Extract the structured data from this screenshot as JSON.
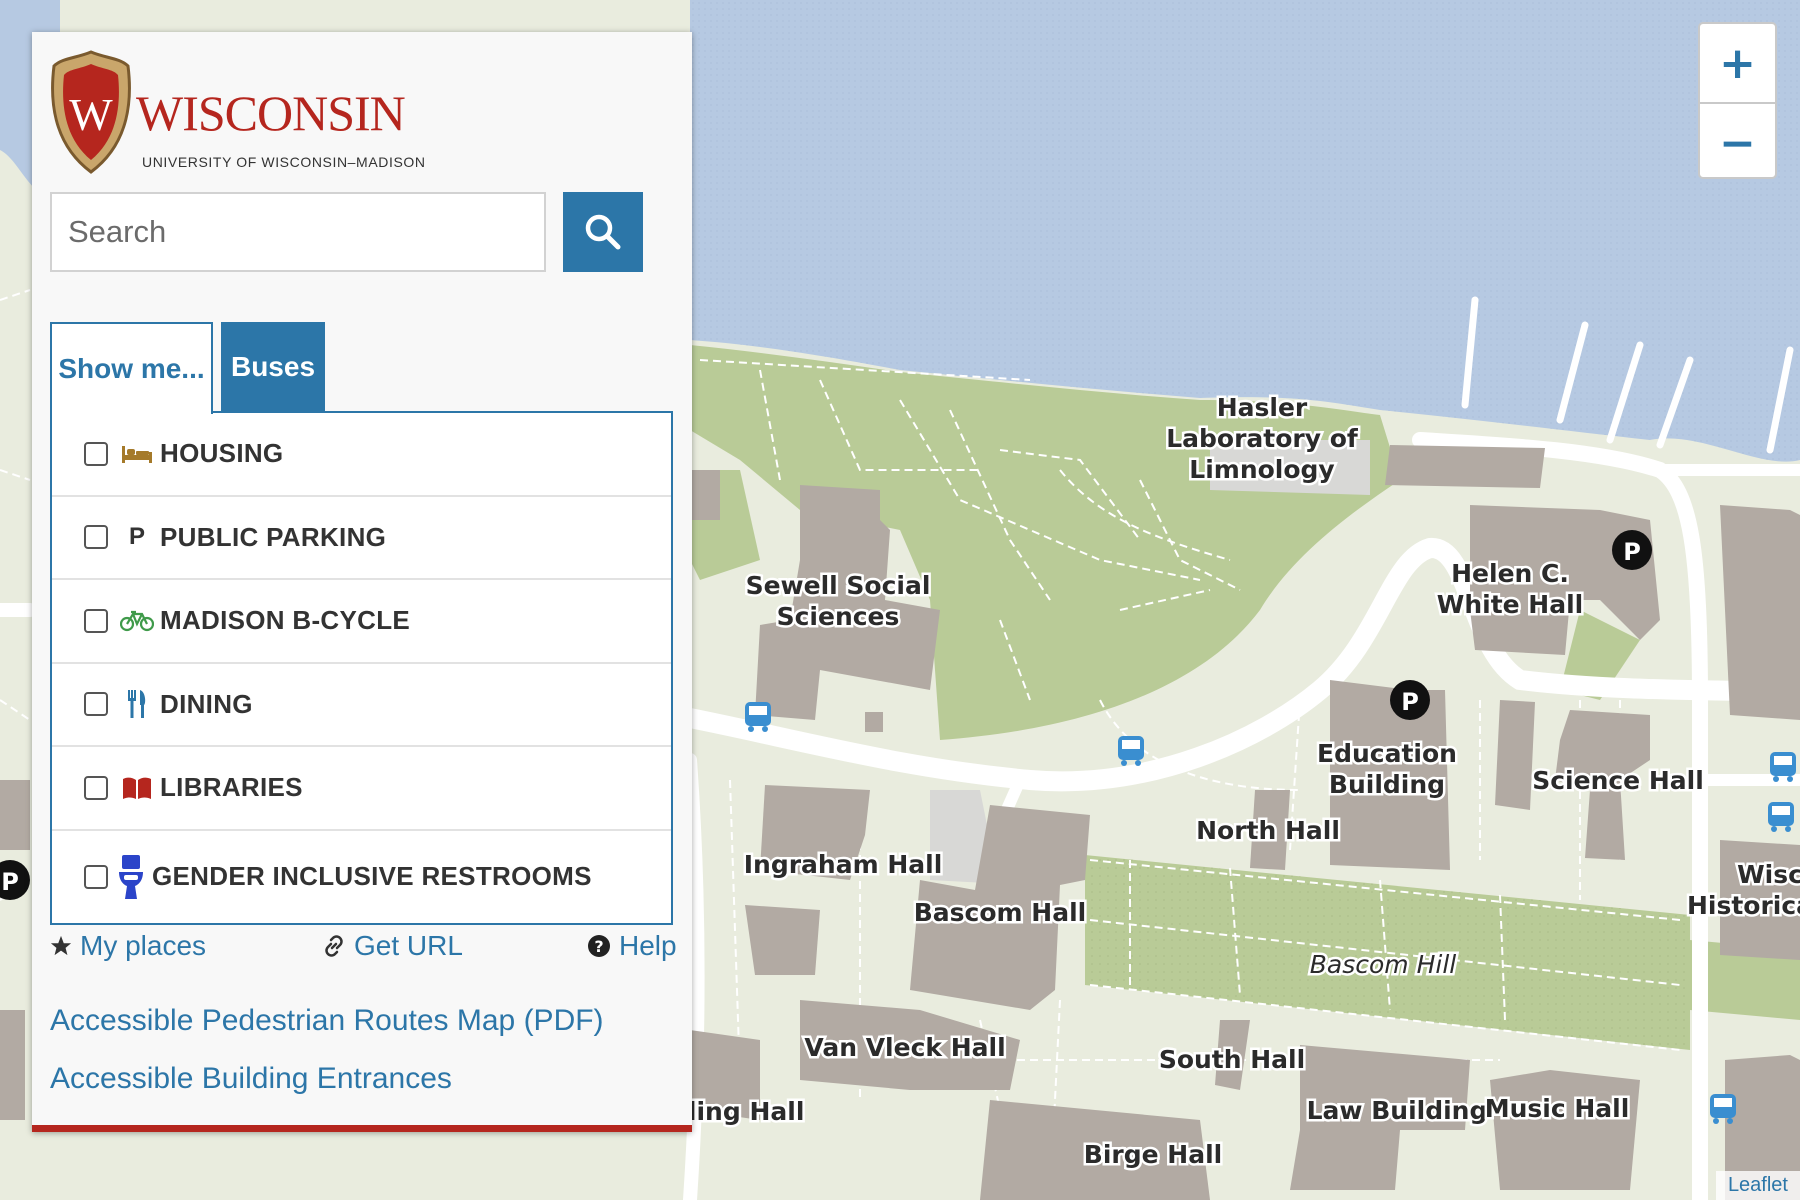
{
  "map": {
    "labels": [
      "Hasler",
      "Laboratory of",
      "Limnology",
      "Sewell Social",
      "Sciences",
      "Helen C.",
      "White Hall",
      "Education",
      "Building",
      "Science Hall",
      "North Hall",
      "Ingraham Hall",
      "Bascom Hall",
      "Bascom Hill",
      "Van Vleck Hall",
      "South Hall",
      "Law Building",
      "Music Hall",
      "Birge Hall",
      "rling Hall",
      "Wisc",
      "Historica"
    ],
    "zoom_in": "+",
    "zoom_out": "−",
    "attribution": "Leaflet",
    "colors": {
      "water": "#b6c9e2",
      "land": "#e9ecde",
      "green": "#b9cb97",
      "building": "#b2aaa3",
      "road": "#ffffff"
    }
  },
  "panel": {
    "logo_word": "WISCONSIN",
    "logo_letter": "W",
    "logo_sub": "UNIVERSITY OF WISCONSIN–MADISON",
    "search_placeholder": "Search",
    "tabs": [
      "Show me...",
      "Buses"
    ],
    "layers": [
      {
        "label": "HOUSING",
        "icon": "bed-icon"
      },
      {
        "label": "PUBLIC PARKING",
        "icon": "parking-icon",
        "glyph": "P"
      },
      {
        "label": "MADISON B-CYCLE",
        "icon": "bicycle-icon"
      },
      {
        "label": "DINING",
        "icon": "utensils-icon"
      },
      {
        "label": "LIBRARIES",
        "icon": "book-icon"
      },
      {
        "label": "GENDER INCLUSIVE RESTROOMS",
        "icon": "toilet-icon"
      }
    ],
    "links": {
      "my_places": "My places",
      "get_url": "Get URL",
      "help": "Help"
    },
    "bottom_links": [
      "Accessible Pedestrian Routes Map (PDF)",
      "Accessible Building Entrances"
    ],
    "accent": "#2c76a8",
    "brand": "#b5261e"
  }
}
